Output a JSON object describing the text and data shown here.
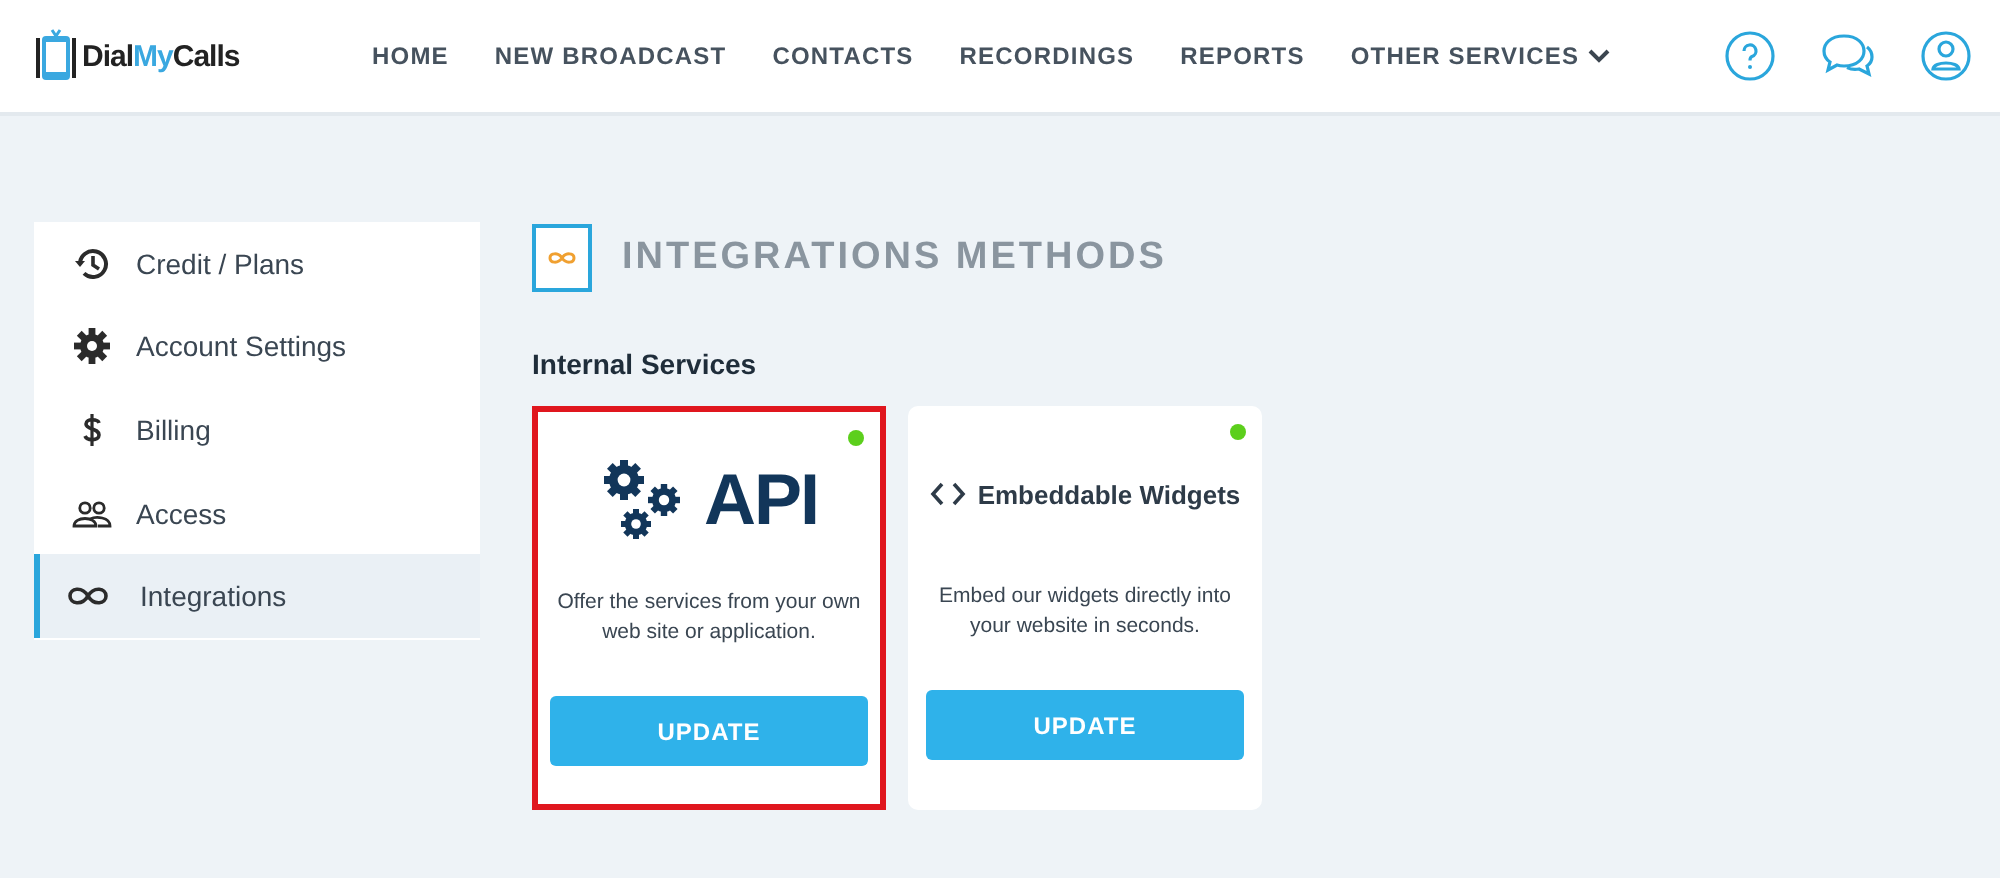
{
  "logo": {
    "text_1": "Dial",
    "text_2": "My",
    "text_3": "Calls"
  },
  "nav": [
    {
      "label": "HOME",
      "dropdown": false
    },
    {
      "label": "NEW BROADCAST",
      "dropdown": false
    },
    {
      "label": "CONTACTS",
      "dropdown": false
    },
    {
      "label": "RECORDINGS",
      "dropdown": false
    },
    {
      "label": "REPORTS",
      "dropdown": false
    },
    {
      "label": "OTHER SERVICES",
      "dropdown": true
    }
  ],
  "header_actions": [
    {
      "kind": "help"
    },
    {
      "kind": "chat"
    },
    {
      "kind": "profile"
    }
  ],
  "sidebar": {
    "items": [
      {
        "label": "Credit / Plans",
        "kind": "history",
        "selected": false
      },
      {
        "label": "Account Settings",
        "kind": "gear",
        "selected": false
      },
      {
        "label": "Billing",
        "kind": "dollar",
        "selected": false
      },
      {
        "label": "Access",
        "kind": "people",
        "selected": false
      },
      {
        "label": "Integrations",
        "kind": "infinity",
        "selected": true
      }
    ]
  },
  "page_title": "INTEGRATIONS METHODS",
  "section_title": "Internal Services",
  "cards": [
    {
      "kind": "api",
      "title": "API",
      "description": "Offer the services from your own web site or application.",
      "button": "UPDATE",
      "highlighted": true,
      "color": "#5ccf1c"
    },
    {
      "kind": "widget",
      "title": "Embeddable Widgets",
      "description": "Embed our widgets directly into your website in seconds.",
      "button": "UPDATE",
      "highlighted": false,
      "color": "#5ccf1c"
    }
  ]
}
